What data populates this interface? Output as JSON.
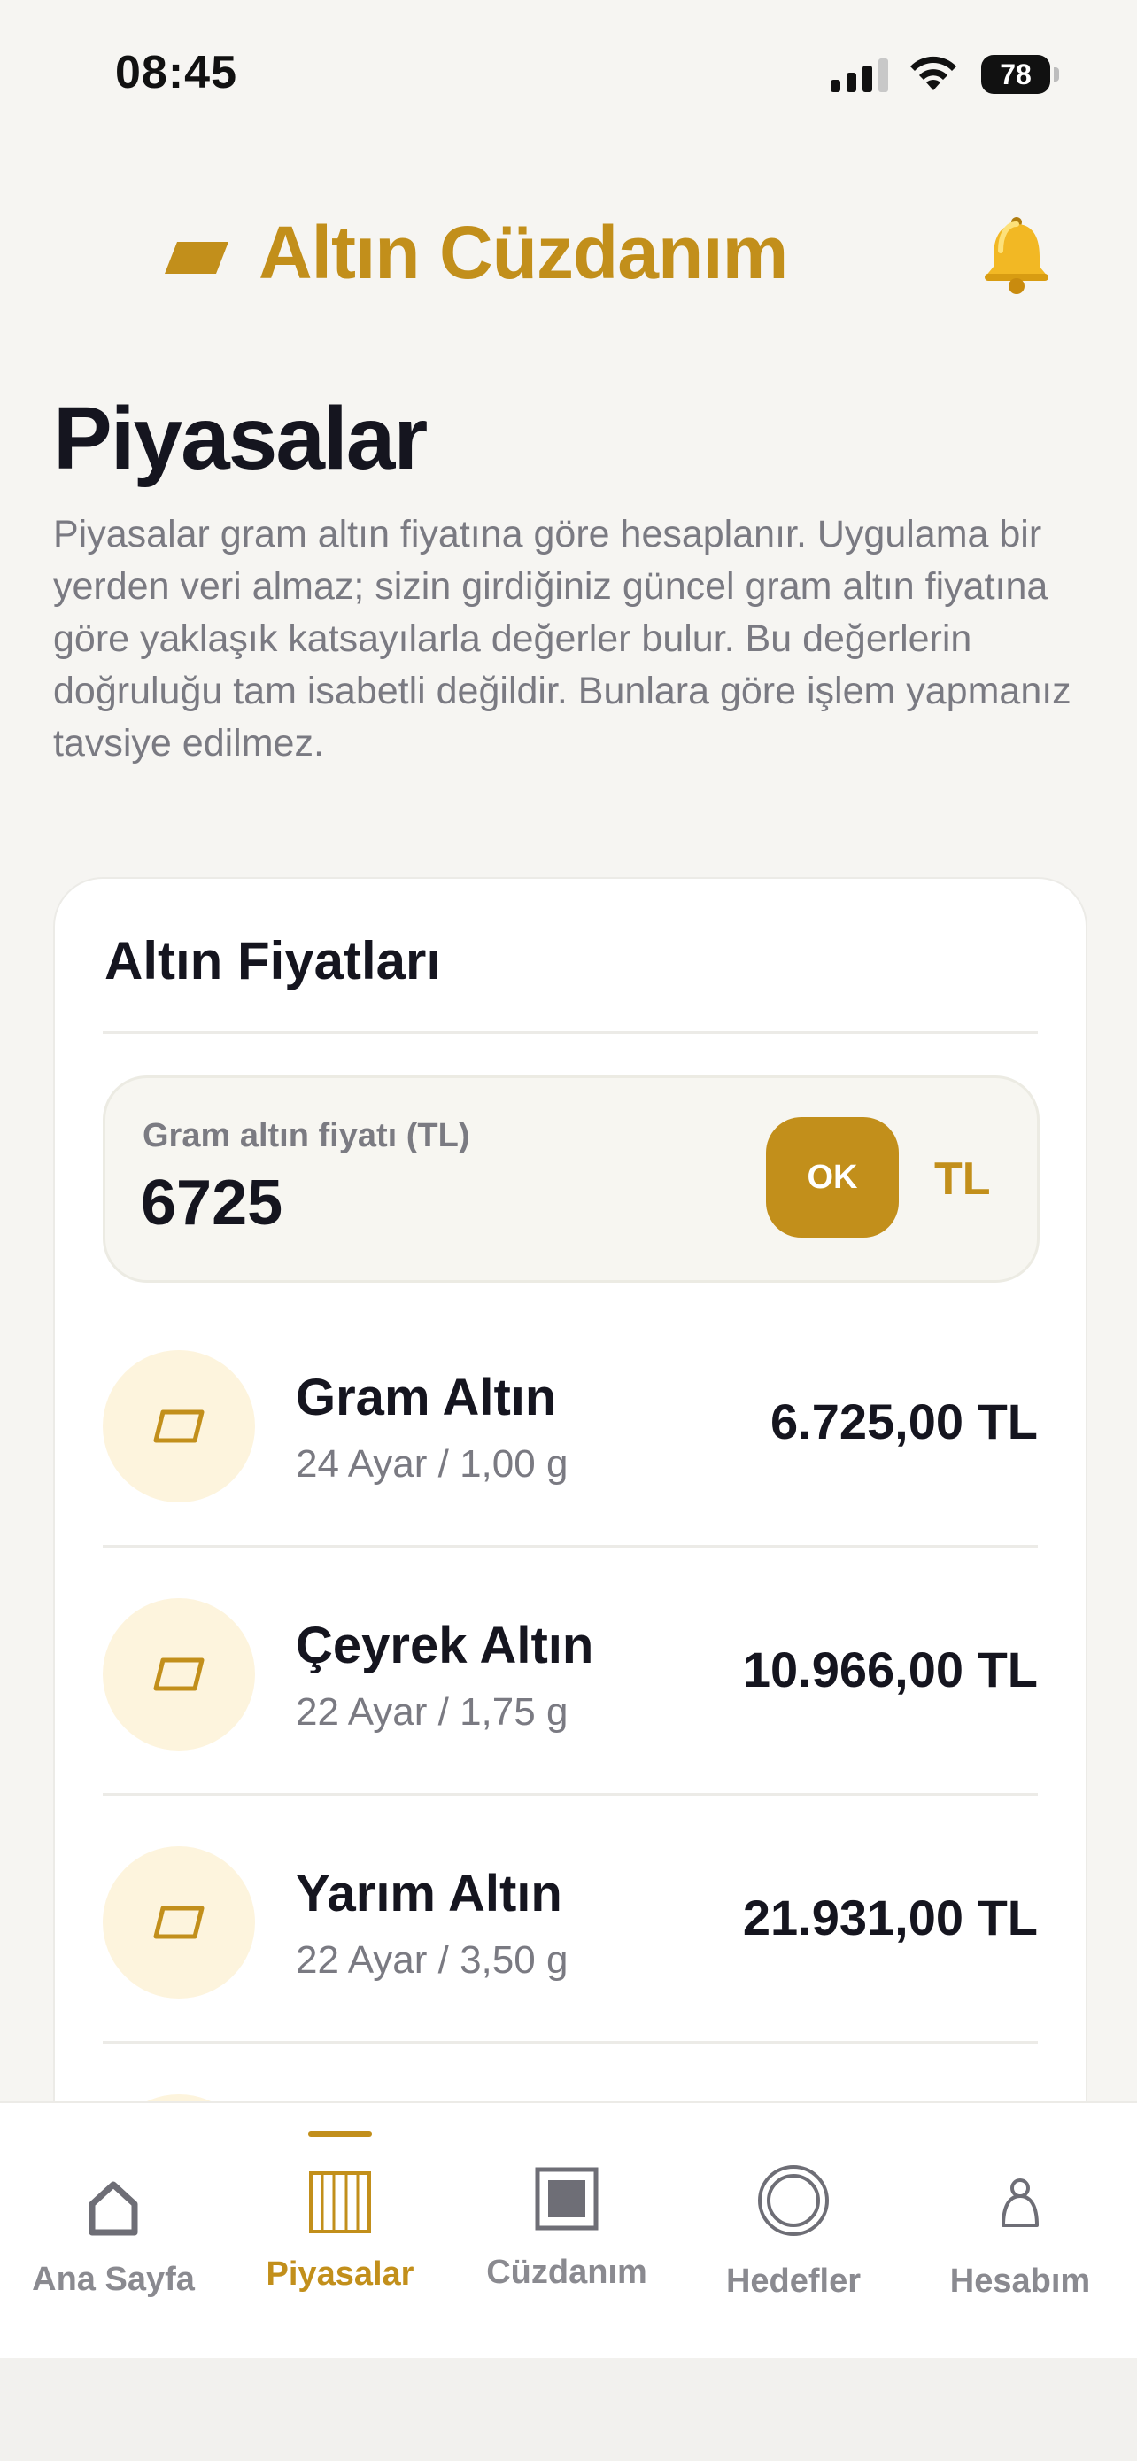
{
  "status_bar": {
    "time": "08:45",
    "battery": "78",
    "icons": [
      "cellular-signal-icon",
      "wifi-icon",
      "battery-icon"
    ]
  },
  "header": {
    "title": "Altın Cüzdanım",
    "logo_icon": "gold-bar-icon",
    "notification_icon": "bell-icon"
  },
  "page": {
    "title": "Piyasalar",
    "description": "Piyasalar gram altın fiyatına göre hesaplanır. Uygulama bir yerden veri almaz; sizin girdiğiniz güncel gram altın fiyatına göre yaklaşık katsayılarla değerler bulur. Bu değerlerin doğruluğu tam isabetli değildir. Bunlara göre işlem yapmanız tavsiye edilmez."
  },
  "card": {
    "title": "Altın Fiyatları",
    "price_input": {
      "label": "Gram altın fiyatı (TL)",
      "value": "6725",
      "ok_label": "OK",
      "unit": "TL"
    },
    "items": [
      {
        "name": "Gram Altın",
        "detail": "24 Ayar / 1,00 g",
        "price": "6.725,00 TL",
        "icon": "gold-bar-icon"
      },
      {
        "name": "Çeyrek Altın",
        "detail": "22 Ayar / 1,75 g",
        "price": "10.966,00 TL",
        "icon": "gold-bar-icon"
      },
      {
        "name": "Yarım Altın",
        "detail": "22 Ayar / 3,50 g",
        "price": "21.931,00 TL",
        "icon": "gold-bar-icon"
      }
    ]
  },
  "bottom_nav": {
    "items": [
      {
        "label": "Ana Sayfa",
        "icon": "home-icon",
        "active": false
      },
      {
        "label": "Piyasalar",
        "icon": "market-icon",
        "active": true
      },
      {
        "label": "Cüzdanım",
        "icon": "wallet-icon",
        "active": false
      },
      {
        "label": "Hedefler",
        "icon": "target-icon",
        "active": false
      },
      {
        "label": "Hesabım",
        "icon": "profile-icon",
        "active": false
      }
    ]
  },
  "colors": {
    "accent": "#c28f1b",
    "background": "#f6f5f2",
    "card": "#ffffff",
    "icon_bg": "#fdf4dd",
    "text": "#15151f",
    "muted": "#7a7a82"
  }
}
